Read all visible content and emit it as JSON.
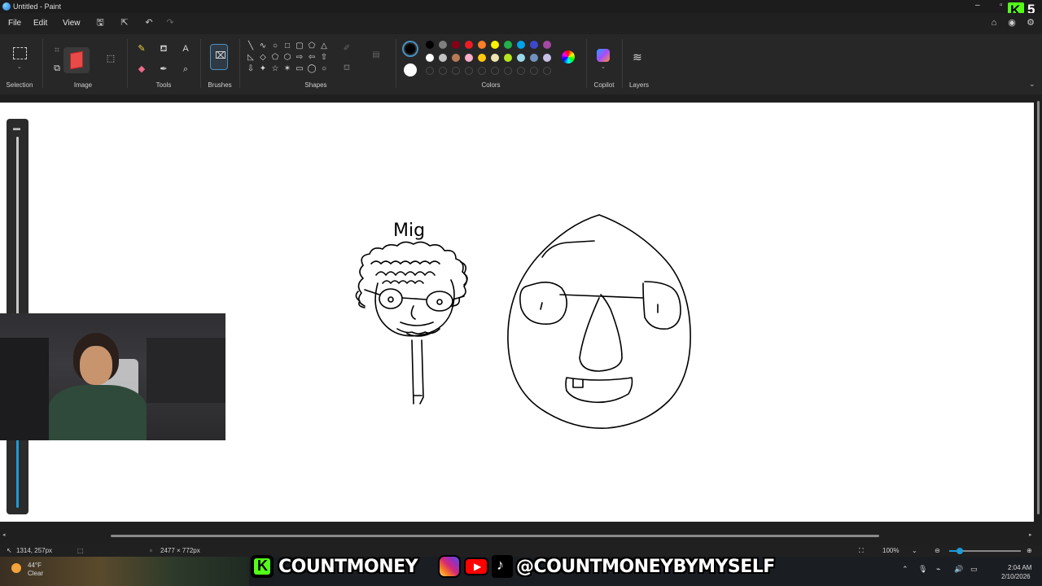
{
  "window": {
    "title": "Untitled - Paint"
  },
  "menu": {
    "file": "File",
    "edit": "Edit",
    "view": "View"
  },
  "ribbon": {
    "groups": {
      "selection": "Selection",
      "image": "Image",
      "tools": "Tools",
      "brushes": "Brushes",
      "shapes": "Shapes",
      "colors": "Colors",
      "copilot": "Copilot",
      "layers": "Layers"
    },
    "colors": {
      "primary": "#000000",
      "secondary": "#ffffff",
      "palette_row1": [
        "#000000",
        "#7f7f7f",
        "#880015",
        "#ed1c24",
        "#ff7f27",
        "#fff200",
        "#22b14c",
        "#00a2e8",
        "#3f48cc",
        "#a349a4"
      ],
      "palette_row2": [
        "#ffffff",
        "#c3c3c3",
        "#b97a57",
        "#ffaec9",
        "#ffc90e",
        "#efe4b0",
        "#b5e61d",
        "#99d9ea",
        "#7092be",
        "#c8bfe7"
      ]
    }
  },
  "canvas": {
    "drawing_label": "Mig"
  },
  "status": {
    "cursor_position": "1314, 257px",
    "canvas_size": "2477 × 772px",
    "zoom": "100%"
  },
  "overlay": {
    "badge_number": "5",
    "badge_letter": "K",
    "banner_left": "COUNTMONEY",
    "banner_right": "@COUNTMONEYBYMYSELF"
  },
  "taskbar": {
    "weather_temp": "44°F",
    "weather_desc": "Clear",
    "time": "2:04 AM",
    "date": "2/10/2026"
  }
}
